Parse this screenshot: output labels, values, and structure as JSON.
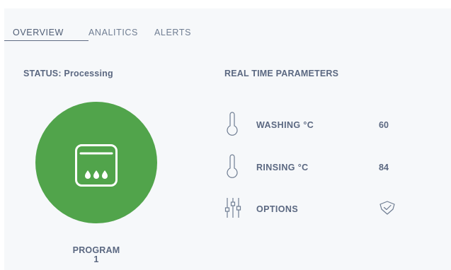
{
  "tabs": [
    {
      "label": "OVERVIEW",
      "active": true
    },
    {
      "label": "ANALITICS",
      "active": false
    },
    {
      "label": "ALERTS",
      "active": false
    }
  ],
  "status": {
    "label": "STATUS:",
    "value": "Processing"
  },
  "realtime": {
    "title": "REAL TIME PARAMETERS",
    "rows": [
      {
        "icon": "thermometer-icon",
        "label": "WASHING °C",
        "value": "60"
      },
      {
        "icon": "thermometer-icon",
        "label": "RINSING °C",
        "value": "84"
      },
      {
        "icon": "sliders-icon",
        "label": "OPTIONS",
        "value_icon": "shield-check-icon"
      }
    ]
  },
  "program": {
    "label": "PROGRAM",
    "number": "1",
    "icon": "washing-program-icon",
    "circle_color": "#51a44b"
  },
  "colors": {
    "accent_green": "#51a44b",
    "text": "#5b6881",
    "panel_bg": "#f6f8fa"
  }
}
